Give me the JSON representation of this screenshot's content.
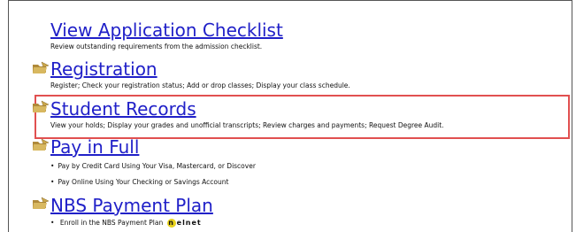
{
  "sections": {
    "checklist": {
      "title": "View Application Checklist",
      "description": "Review outstanding requirements from the admission checklist."
    },
    "registration": {
      "title": "Registration",
      "description": "Register; Check your registration status; Add or drop classes; Display your class schedule."
    },
    "student_records": {
      "title": "Student Records",
      "description": "View your holds; Display your grades and unofficial transcripts; Review charges and payments; Request Degree Audit."
    },
    "pay_in_full": {
      "title": "Pay in Full",
      "bullets": [
        "Pay by Credit Card Using Your Visa, Mastercard, or Discover",
        "Pay Online Using Your Checking or Savings Account"
      ]
    },
    "nbs_plan": {
      "title": "NBS Payment Plan",
      "bullet": "Enroll in the NBS Payment Plan",
      "logo_text": "nelnet",
      "logo_letter": "n"
    }
  },
  "colors": {
    "link": "#2020c8",
    "highlight": "#e15050",
    "folder": "#c9a64a",
    "nelnet_yellow": "#e8d21c"
  },
  "icons": [
    "folder-arrow-icon"
  ]
}
